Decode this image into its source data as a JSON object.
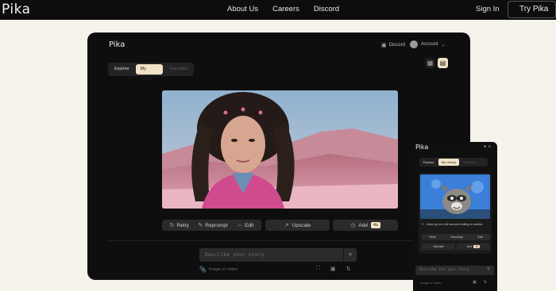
{
  "site": {
    "logo": "Pika",
    "nav": [
      "About Us",
      "Careers",
      "Discord"
    ],
    "sign_in": "Sign In",
    "try_button": "Try Pika"
  },
  "app": {
    "logo": "Pika",
    "discord": "Discord",
    "account": "Account",
    "tabs": {
      "explore": "Explore",
      "library": "My Library",
      "favorites": "Favorites"
    },
    "actions": {
      "retry": "Retry",
      "reprompt": "Reprompt",
      "edit": "Edit",
      "upscale": "Upscale",
      "add": "Add",
      "add_badge": "4s"
    },
    "prompt_placeholder": "Describe your story",
    "image_or_video": "Image or video"
  },
  "mobile": {
    "logo": "Pika",
    "tabs": {
      "explore": "Explore",
      "library": "My Library",
      "favorites": "Favorites"
    },
    "caption": "Zoom up on a 3d raccoon smiling to camera",
    "actions": {
      "retry": "Retry",
      "reprompt": "Reprompt",
      "edit": "Edit",
      "upscale": "Upscale",
      "add": "Add",
      "add_badge": "4s"
    },
    "prompt_placeholder": "Describe the your story",
    "image_or_video": "Image or video"
  },
  "colors": {
    "accent": "#f1e3c7",
    "page_bg": "#f6f3ec",
    "app_bg": "#0e0e0e"
  }
}
